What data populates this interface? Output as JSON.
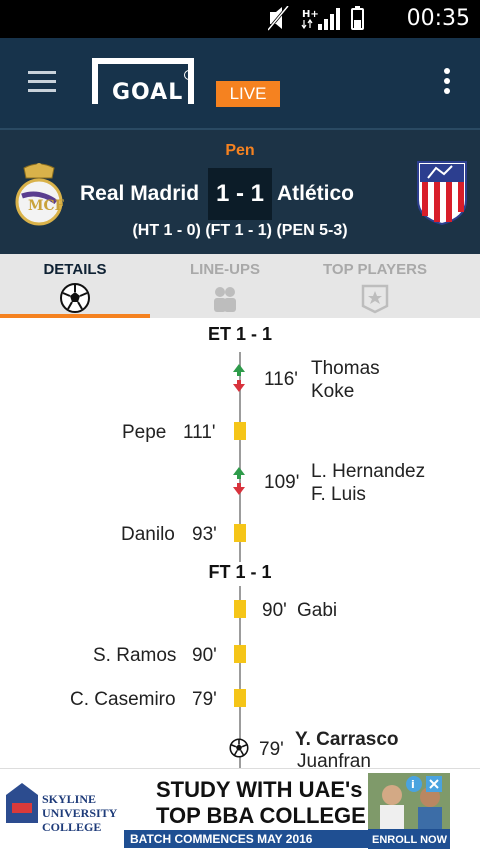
{
  "status_bar": {
    "time": "00:35",
    "network": "H+"
  },
  "app_bar": {
    "logo_text": "GOAL",
    "live_label": "LIVE"
  },
  "match": {
    "status": "Pen",
    "home_team": "Real Madrid",
    "away_team": "Atlético",
    "score": "1 - 1",
    "detail": "(HT 1 - 0) (FT 1 - 1) (PEN 5-3)"
  },
  "tabs": [
    {
      "label": "DETAILS",
      "icon": "soccer-ball-icon",
      "active": true
    },
    {
      "label": "LINE-UPS",
      "icon": "lineup-icon",
      "active": false
    },
    {
      "label": "TOP PLAYERS",
      "icon": "star-badge-icon",
      "active": false
    }
  ],
  "timeline": {
    "et_heading": "ET 1 - 1",
    "ft_heading": "FT 1 - 1",
    "events": [
      {
        "type": "substitution",
        "side": "away",
        "minute": "116'",
        "player_in": "Thomas",
        "player_out": "Koke"
      },
      {
        "type": "yellow-card",
        "side": "home",
        "minute": "111'",
        "player": "Pepe"
      },
      {
        "type": "substitution",
        "side": "away",
        "minute": "109'",
        "player_in": "L. Hernandez",
        "player_out": "F. Luis"
      },
      {
        "type": "yellow-card",
        "side": "home",
        "minute": "93'",
        "player": "Danilo"
      },
      {
        "type": "yellow-card",
        "side": "away",
        "minute": "90'",
        "player": "Gabi"
      },
      {
        "type": "yellow-card",
        "side": "home",
        "minute": "90'",
        "player": "S. Ramos"
      },
      {
        "type": "yellow-card",
        "side": "home",
        "minute": "79'",
        "player": "C. Casemiro"
      },
      {
        "type": "goal",
        "side": "away",
        "minute": "79'",
        "player": "Y. Carrasco",
        "assist": "Juanfran"
      }
    ]
  },
  "ad": {
    "brand_line1": "SKYLINE",
    "brand_line2": "UNIVERSITY",
    "brand_line3": "COLLEGE",
    "headline1": "STUDY WITH UAE's",
    "headline2": "TOP BBA COLLEGE",
    "banner": "BATCH COMMENCES MAY 2016",
    "cta": "ENROLL NOW"
  },
  "colors": {
    "accent": "#f58220",
    "header_bg": "#17334b",
    "score_bg": "#1c3346",
    "card": "#f5c518"
  }
}
